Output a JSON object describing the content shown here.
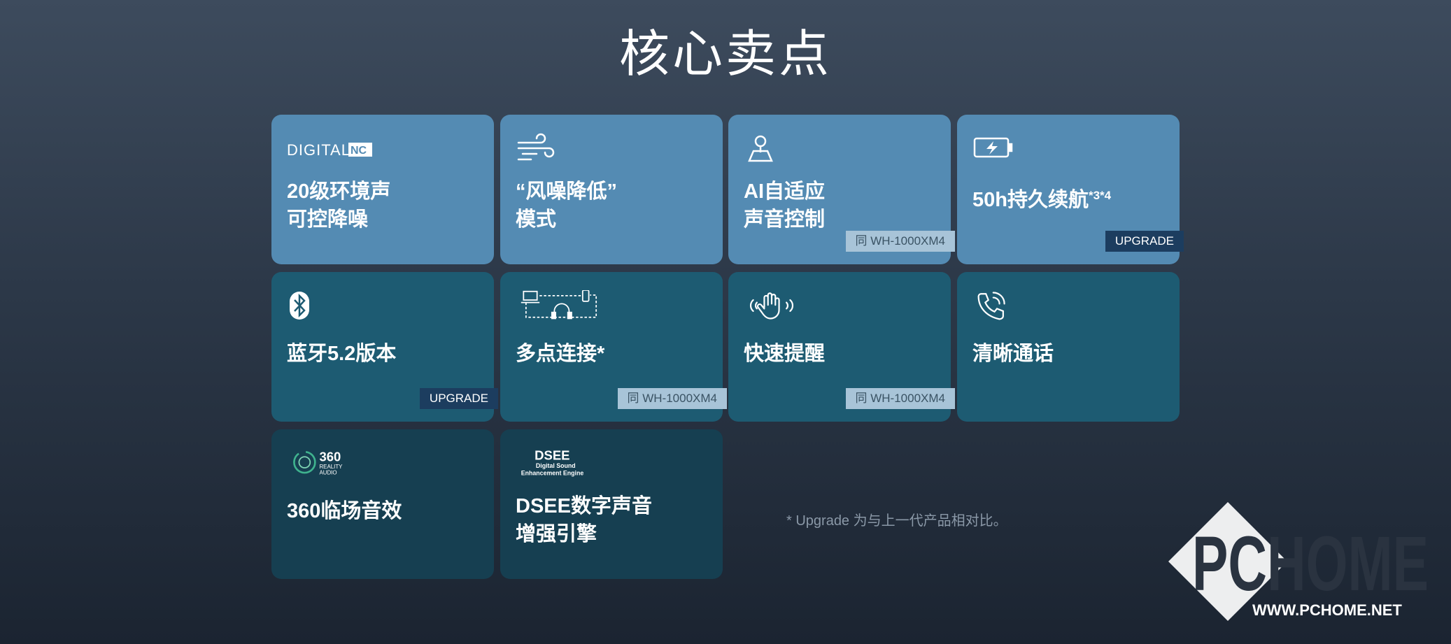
{
  "page": {
    "title": "核心卖点"
  },
  "cards": [
    {
      "icon": "digital-nc-logo",
      "logo_text": "DIGITAL",
      "logo_mark": "NC",
      "label_line1": "20级环境声",
      "label_line2": "可控降噪"
    },
    {
      "icon": "wind-icon",
      "label_line1": "“风噪降低”",
      "label_line2": "模式"
    },
    {
      "icon": "location-pin-icon",
      "label_line1": "AI自适应",
      "label_line2": "声音控制",
      "badge": "同 WH-1000XM4"
    },
    {
      "icon": "battery-charging-icon",
      "label_line1": "50h持久续航",
      "label_sup": "*3*4",
      "badge": "UPGRADE"
    },
    {
      "icon": "bluetooth-icon",
      "label_line1": "蓝牙5.2版本",
      "badge": "UPGRADE"
    },
    {
      "icon": "multipoint-connection-icon",
      "label_line1": "多点连接*",
      "badge": "同 WH-1000XM4"
    },
    {
      "icon": "hand-wave-icon",
      "label_line1": "快速提醒",
      "badge": "同 WH-1000XM4"
    },
    {
      "icon": "phone-call-icon",
      "label_line1": "清晰通话"
    },
    {
      "icon": "360-reality-audio-logo",
      "logo_big": "360",
      "logo_small1": "REALITY",
      "logo_small2": "AUDIO",
      "label_line1": "360临场音效"
    },
    {
      "icon": "dsee-logo",
      "logo_big": "DSEE",
      "logo_small1": "Digital Sound",
      "logo_small2": "Enhancement Engine",
      "label_line1": "DSEE数字声音",
      "label_line2": "增强引擎"
    }
  ],
  "footnote": "* Upgrade 为与上一代产品相对比。",
  "watermark": {
    "brand": "PCHOME",
    "url": "WWW.PCHOME.NET"
  }
}
